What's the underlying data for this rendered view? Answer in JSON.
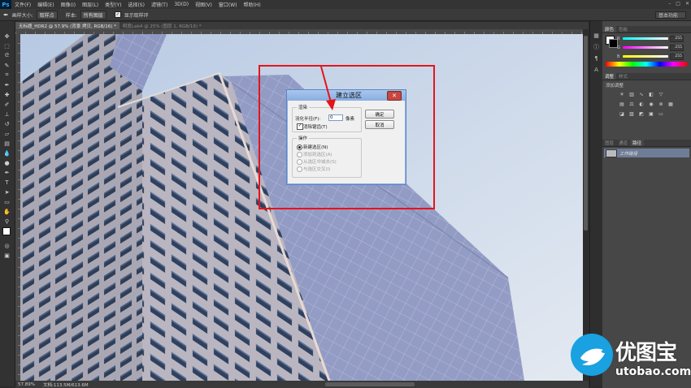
{
  "app": {
    "logo": "Ps"
  },
  "menu": [
    "文件(F)",
    "编辑(E)",
    "图像(I)",
    "图层(L)",
    "类型(Y)",
    "选择(S)",
    "滤镜(T)",
    "3D(D)",
    "视图(V)",
    "窗口(W)",
    "帮助(H)"
  ],
  "options_bar": {
    "size_label": "画样大小:",
    "size_value": "取样点",
    "sample_label": "样本:",
    "sample_value": "所有图层",
    "checkbox_label": "显示取样环",
    "workspace": "基本功能"
  },
  "document": {
    "active_tab": "无标题_HDR2 @ 57.9% (背景 拷贝, RGB/16) *",
    "inactive_tab": "明度Lab4 @ 25% (图层 1, RGB/16) *",
    "status_zoom": "57.89%",
    "status_doc": "文档:113.5M/613.6M"
  },
  "panels": {
    "color_tabs": [
      "颜色",
      "色板"
    ],
    "rgb": [
      {
        "label": "R",
        "value": "255",
        "color_start": "#00ffff",
        "color_end": "#ffffff"
      },
      {
        "label": "G",
        "value": "255",
        "color_start": "#ff00ff",
        "color_end": "#ffffff"
      },
      {
        "label": "B",
        "value": "255",
        "color_start": "#ffff00",
        "color_end": "#ffffff"
      }
    ],
    "adjust_tabs": [
      "调整",
      "样式"
    ],
    "adjust_title": "添加调整",
    "layers_tabs": [
      "图层",
      "通道",
      "路径"
    ],
    "path_item": "工作路径"
  },
  "dialog": {
    "title": "建立选区",
    "render_legend": "渲染",
    "feather_label": "羽化半径(F):",
    "feather_value": "0",
    "feather_unit": "像素",
    "antialias_label": "消除锯齿(T)",
    "antialias_checked": true,
    "ok_label": "确定",
    "cancel_label": "取消",
    "operation_legend": "操作",
    "operations": [
      {
        "label": "新建选区(N)",
        "checked": true,
        "enabled": true
      },
      {
        "label": "添加到选区(A)",
        "checked": false,
        "enabled": false
      },
      {
        "label": "从选区中减去(S)",
        "checked": false,
        "enabled": false
      },
      {
        "label": "与选区交叉(I)",
        "checked": false,
        "enabled": false
      }
    ]
  },
  "watermark": {
    "brand": "优图宝",
    "url": "utobao.com"
  },
  "colors": {
    "highlight": "#e5141b",
    "arrow": "#e5141b",
    "title_bar": "#88aee0"
  }
}
